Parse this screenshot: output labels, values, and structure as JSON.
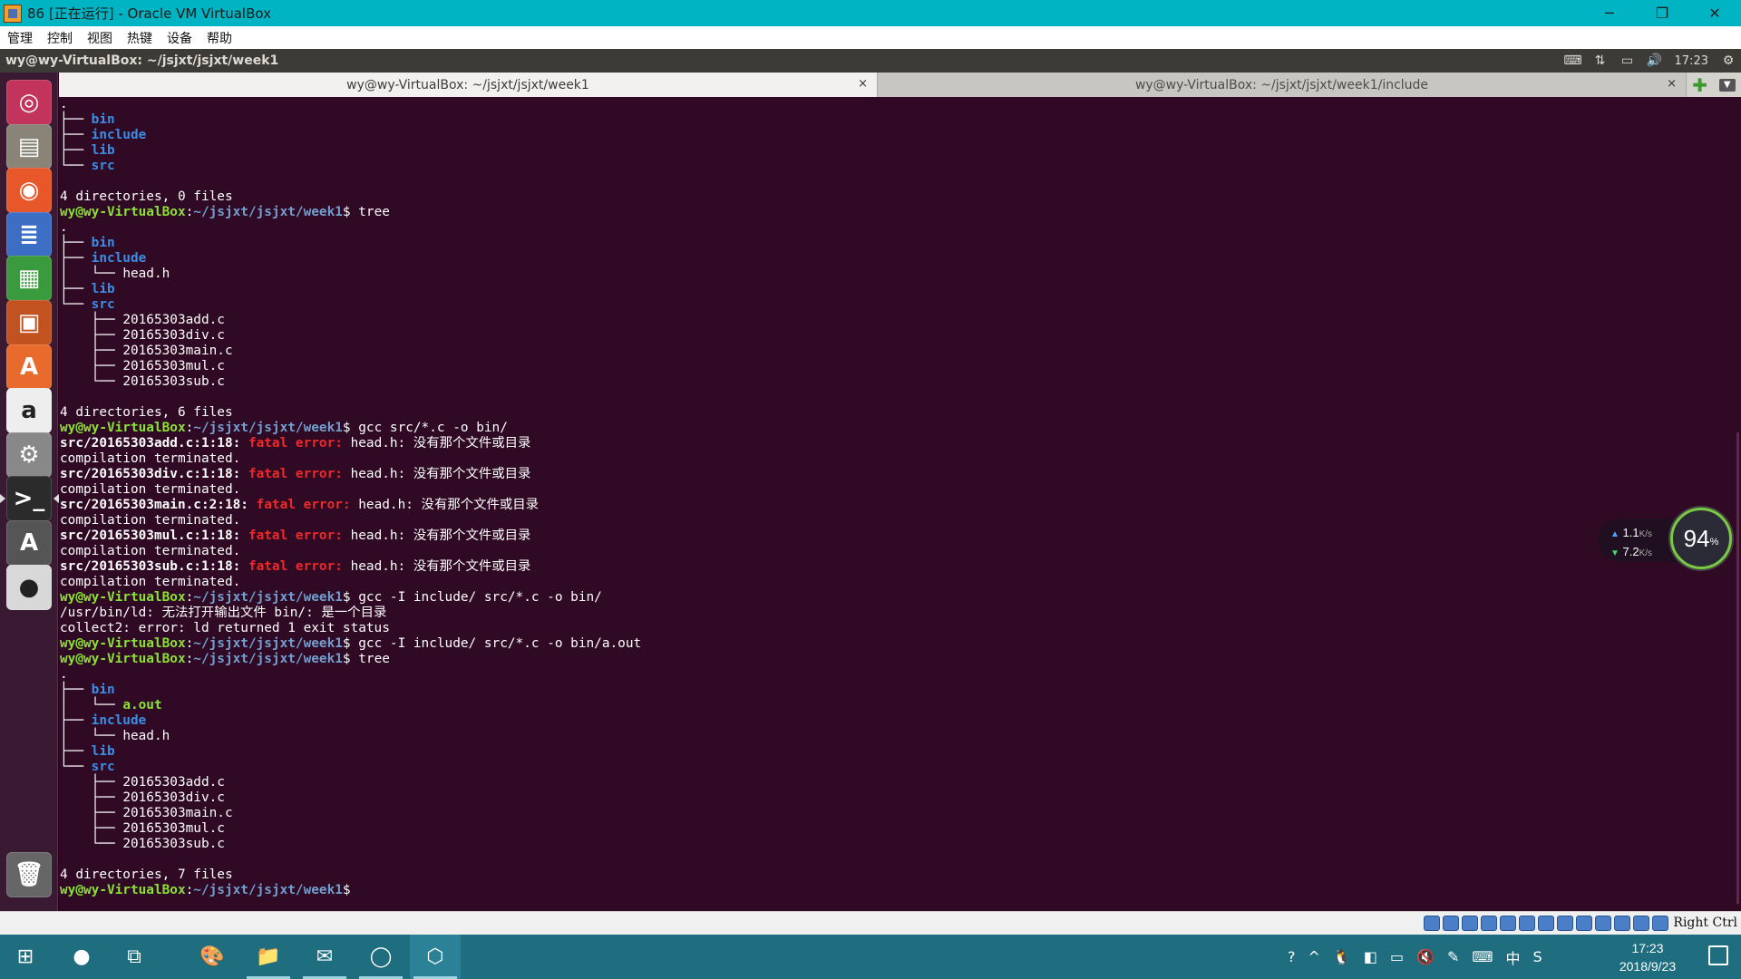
{
  "window": {
    "title": "86 [正在运行] - Oracle VM VirtualBox",
    "controls": {
      "minimize": "─",
      "restore": "❐",
      "close": "✕"
    }
  },
  "vb_menu": [
    "管理",
    "控制",
    "视图",
    "热键",
    "设备",
    "帮助"
  ],
  "ubuntu_panel": {
    "title": "wy@wy-VirtualBox: ~/jsjxt/jsjxt/week1",
    "time": "17:23",
    "icons": [
      "keyboard-icon",
      "network-icon",
      "battery-icon",
      "volume-icon",
      "gear-icon"
    ]
  },
  "launcher": [
    {
      "name": "ubuntu-dash",
      "glyph": "◎",
      "bg": "#c2345c"
    },
    {
      "name": "files",
      "glyph": "▤",
      "bg": "#8a8478"
    },
    {
      "name": "firefox",
      "glyph": "◉",
      "bg": "#e8572a"
    },
    {
      "name": "writer",
      "glyph": "≣",
      "bg": "#3d6ec6"
    },
    {
      "name": "calc",
      "glyph": "▦",
      "bg": "#3a9a3e"
    },
    {
      "name": "impress",
      "glyph": "▣",
      "bg": "#c2521f"
    },
    {
      "name": "software-center",
      "glyph": "A",
      "bg": "#e86a2c"
    },
    {
      "name": "amazon",
      "glyph": "a",
      "bg": "#eeeeee"
    },
    {
      "name": "system-settings",
      "glyph": "⚙",
      "bg": "#888888"
    },
    {
      "name": "terminal",
      "glyph": ">_",
      "bg": "#2b2b2b"
    },
    {
      "name": "software-updater",
      "glyph": "A",
      "bg": "#555555"
    },
    {
      "name": "dvd",
      "glyph": "●",
      "bg": "#d8d8d8"
    },
    {
      "name": "trash",
      "glyph": "🗑",
      "bg": "#666666"
    }
  ],
  "tabs": [
    {
      "title": "wy@wy-VirtualBox: ~/jsjxt/jsjxt/week1",
      "close": "×"
    },
    {
      "title": "wy@wy-VirtualBox: ~/jsjxt/jsjxt/week1/include",
      "close": "×"
    }
  ],
  "terminal": {
    "prompt": "wy@wy-VirtualBox",
    "lines": [
      [
        {
          "c": "t-tree",
          "t": "."
        }
      ],
      [
        {
          "c": "t-tree",
          "t": "├── "
        },
        {
          "c": "t-dir",
          "t": "bin"
        }
      ],
      [
        {
          "c": "t-tree",
          "t": "├── "
        },
        {
          "c": "t-dir",
          "t": "include"
        }
      ],
      [
        {
          "c": "t-tree",
          "t": "├── "
        },
        {
          "c": "t-dir",
          "t": "lib"
        }
      ],
      [
        {
          "c": "t-tree",
          "t": "└── "
        },
        {
          "c": "t-dir",
          "t": "src"
        }
      ],
      [
        {
          "c": "",
          "t": ""
        }
      ],
      [
        {
          "c": "",
          "t": "4 directories, 0 files"
        }
      ],
      [
        {
          "c": "t-prompt",
          "t": "wy@wy-VirtualBox"
        },
        {
          "c": "",
          "t": ":"
        },
        {
          "c": "t-path",
          "t": "~/jsjxt/jsjxt/week1"
        },
        {
          "c": "",
          "t": "$ tree"
        }
      ],
      [
        {
          "c": "t-tree",
          "t": "."
        }
      ],
      [
        {
          "c": "t-tree",
          "t": "├── "
        },
        {
          "c": "t-dir",
          "t": "bin"
        }
      ],
      [
        {
          "c": "t-tree",
          "t": "├── "
        },
        {
          "c": "t-dir",
          "t": "include"
        }
      ],
      [
        {
          "c": "t-tree",
          "t": "│   └── "
        },
        {
          "c": "",
          "t": "head.h"
        }
      ],
      [
        {
          "c": "t-tree",
          "t": "├── "
        },
        {
          "c": "t-dir",
          "t": "lib"
        }
      ],
      [
        {
          "c": "t-tree",
          "t": "└── "
        },
        {
          "c": "t-dir",
          "t": "src"
        }
      ],
      [
        {
          "c": "t-tree",
          "t": "    ├── "
        },
        {
          "c": "",
          "t": "20165303add.c"
        }
      ],
      [
        {
          "c": "t-tree",
          "t": "    ├── "
        },
        {
          "c": "",
          "t": "20165303div.c"
        }
      ],
      [
        {
          "c": "t-tree",
          "t": "    ├── "
        },
        {
          "c": "",
          "t": "20165303main.c"
        }
      ],
      [
        {
          "c": "t-tree",
          "t": "    ├── "
        },
        {
          "c": "",
          "t": "20165303mul.c"
        }
      ],
      [
        {
          "c": "t-tree",
          "t": "    └── "
        },
        {
          "c": "",
          "t": "20165303sub.c"
        }
      ],
      [
        {
          "c": "",
          "t": ""
        }
      ],
      [
        {
          "c": "",
          "t": "4 directories, 6 files"
        }
      ],
      [
        {
          "c": "t-prompt",
          "t": "wy@wy-VirtualBox"
        },
        {
          "c": "",
          "t": ":"
        },
        {
          "c": "t-path",
          "t": "~/jsjxt/jsjxt/week1"
        },
        {
          "c": "",
          "t": "$ gcc src/*.c -o bin/"
        }
      ],
      [
        {
          "c": "t-bold",
          "t": "src/20165303add.c:1:18: "
        },
        {
          "c": "t-err",
          "t": "fatal error: "
        },
        {
          "c": "",
          "t": "head.h: 没有那个文件或目录"
        }
      ],
      [
        {
          "c": "",
          "t": "compilation terminated."
        }
      ],
      [
        {
          "c": "t-bold",
          "t": "src/20165303div.c:1:18: "
        },
        {
          "c": "t-err",
          "t": "fatal error: "
        },
        {
          "c": "",
          "t": "head.h: 没有那个文件或目录"
        }
      ],
      [
        {
          "c": "",
          "t": "compilation terminated."
        }
      ],
      [
        {
          "c": "t-bold",
          "t": "src/20165303main.c:2:18: "
        },
        {
          "c": "t-err",
          "t": "fatal error: "
        },
        {
          "c": "",
          "t": "head.h: 没有那个文件或目录"
        }
      ],
      [
        {
          "c": "",
          "t": "compilation terminated."
        }
      ],
      [
        {
          "c": "t-bold",
          "t": "src/20165303mul.c:1:18: "
        },
        {
          "c": "t-err",
          "t": "fatal error: "
        },
        {
          "c": "",
          "t": "head.h: 没有那个文件或目录"
        }
      ],
      [
        {
          "c": "",
          "t": "compilation terminated."
        }
      ],
      [
        {
          "c": "t-bold",
          "t": "src/20165303sub.c:1:18: "
        },
        {
          "c": "t-err",
          "t": "fatal error: "
        },
        {
          "c": "",
          "t": "head.h: 没有那个文件或目录"
        }
      ],
      [
        {
          "c": "",
          "t": "compilation terminated."
        }
      ],
      [
        {
          "c": "t-prompt",
          "t": "wy@wy-VirtualBox"
        },
        {
          "c": "",
          "t": ":"
        },
        {
          "c": "t-path",
          "t": "~/jsjxt/jsjxt/week1"
        },
        {
          "c": "",
          "t": "$ gcc -I include/ src/*.c -o bin/"
        }
      ],
      [
        {
          "c": "",
          "t": "/usr/bin/ld: 无法打开输出文件 bin/: 是一个目录"
        }
      ],
      [
        {
          "c": "",
          "t": "collect2: error: ld returned 1 exit status"
        }
      ],
      [
        {
          "c": "t-prompt",
          "t": "wy@wy-VirtualBox"
        },
        {
          "c": "",
          "t": ":"
        },
        {
          "c": "t-path",
          "t": "~/jsjxt/jsjxt/week1"
        },
        {
          "c": "",
          "t": "$ gcc -I include/ src/*.c -o bin/a.out"
        }
      ],
      [
        {
          "c": "t-prompt",
          "t": "wy@wy-VirtualBox"
        },
        {
          "c": "",
          "t": ":"
        },
        {
          "c": "t-path",
          "t": "~/jsjxt/jsjxt/week1"
        },
        {
          "c": "",
          "t": "$ tree"
        }
      ],
      [
        {
          "c": "t-tree",
          "t": "."
        }
      ],
      [
        {
          "c": "t-tree",
          "t": "├── "
        },
        {
          "c": "t-dir",
          "t": "bin"
        }
      ],
      [
        {
          "c": "t-tree",
          "t": "│   └── "
        },
        {
          "c": "t-exe",
          "t": "a.out"
        }
      ],
      [
        {
          "c": "t-tree",
          "t": "├── "
        },
        {
          "c": "t-dir",
          "t": "include"
        }
      ],
      [
        {
          "c": "t-tree",
          "t": "│   └── "
        },
        {
          "c": "",
          "t": "head.h"
        }
      ],
      [
        {
          "c": "t-tree",
          "t": "├── "
        },
        {
          "c": "t-dir",
          "t": "lib"
        }
      ],
      [
        {
          "c": "t-tree",
          "t": "└── "
        },
        {
          "c": "t-dir",
          "t": "src"
        }
      ],
      [
        {
          "c": "t-tree",
          "t": "    ├── "
        },
        {
          "c": "",
          "t": "20165303add.c"
        }
      ],
      [
        {
          "c": "t-tree",
          "t": "    ├── "
        },
        {
          "c": "",
          "t": "20165303div.c"
        }
      ],
      [
        {
          "c": "t-tree",
          "t": "    ├── "
        },
        {
          "c": "",
          "t": "20165303main.c"
        }
      ],
      [
        {
          "c": "t-tree",
          "t": "    ├── "
        },
        {
          "c": "",
          "t": "20165303mul.c"
        }
      ],
      [
        {
          "c": "t-tree",
          "t": "    └── "
        },
        {
          "c": "",
          "t": "20165303sub.c"
        }
      ],
      [
        {
          "c": "",
          "t": ""
        }
      ],
      [
        {
          "c": "",
          "t": "4 directories, 7 files"
        }
      ],
      [
        {
          "c": "t-prompt",
          "t": "wy@wy-VirtualBox"
        },
        {
          "c": "",
          "t": ":"
        },
        {
          "c": "t-path",
          "t": "~/jsjxt/jsjxt/week1"
        },
        {
          "c": "",
          "t": "$ "
        }
      ]
    ]
  },
  "net_widget": {
    "up": "1.1",
    "up_unit": "K/s",
    "down": "7.2",
    "down_unit": "K/s",
    "percent": "94",
    "percent_sign": "%"
  },
  "vb_status": {
    "host_key": "Right Ctrl",
    "icon_count": 13
  },
  "taskbar": {
    "time": "17:23",
    "date": "2018/9/23",
    "ime": "中",
    "apps": [
      "start-icon",
      "cortana-icon",
      "task-view-icon",
      "paint-icon",
      "explorer-icon",
      "kingsoft-icon",
      "qq-browser-icon",
      "virtualbox-icon"
    ]
  },
  "colors": {
    "terminal_bg": "#300a24",
    "prompt_green": "#8ae234",
    "path_blue": "#729fcf",
    "error_red": "#ef2929",
    "taskbar": "#1e6e80",
    "titlebar": "#00b4c3"
  }
}
